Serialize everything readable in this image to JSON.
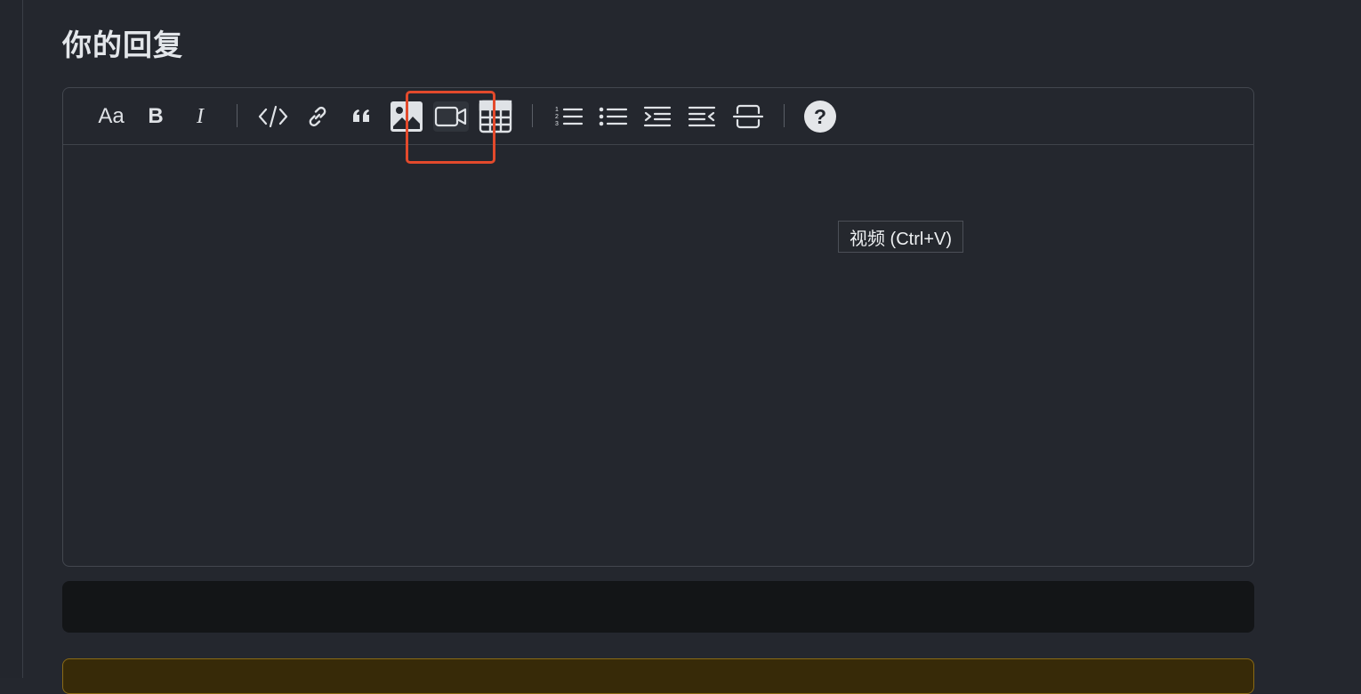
{
  "page": {
    "title": "你的回复"
  },
  "toolbar": {
    "items": [
      {
        "label": "Aa",
        "icon": "font-size-icon"
      },
      {
        "label": "B",
        "icon": "bold-icon"
      },
      {
        "label": "I",
        "icon": "italic-icon"
      },
      {
        "label": "",
        "icon": "code-icon"
      },
      {
        "label": "",
        "icon": "link-icon"
      },
      {
        "label": "",
        "icon": "quote-icon"
      },
      {
        "label": "",
        "icon": "image-icon"
      },
      {
        "label": "",
        "icon": "video-icon"
      },
      {
        "label": "",
        "icon": "table-icon"
      },
      {
        "label": "",
        "icon": "ordered-list-icon"
      },
      {
        "label": "",
        "icon": "bullet-list-icon"
      },
      {
        "label": "",
        "icon": "indent-icon"
      },
      {
        "label": "",
        "icon": "outdent-icon"
      },
      {
        "label": "",
        "icon": "strikethrough-icon"
      },
      {
        "label": "",
        "icon": "help-icon"
      }
    ],
    "active_item": "video-icon"
  },
  "tooltip": {
    "text": "视频 (Ctrl+V)"
  },
  "colors": {
    "background": "#24272e",
    "highlight": "#e34a2c",
    "notice_background": "#372a08",
    "notice_border": "#8a6a14",
    "preview_bar": "#131517"
  }
}
